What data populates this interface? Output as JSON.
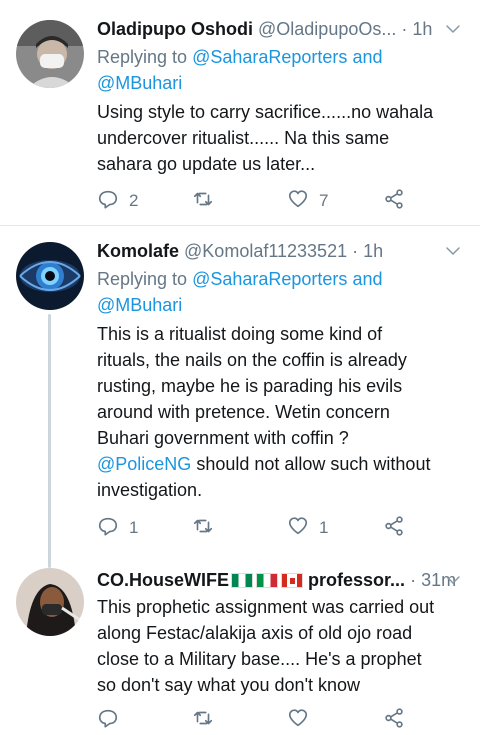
{
  "tweets": [
    {
      "name": "Oladipupo Oshodi",
      "handle": "@OladipupoOs...",
      "dot": "·",
      "time": "1h",
      "replying_label": "Replying to",
      "mention1": "@SaharaReporters",
      "and_word": "and",
      "mention2": "@MBuhari",
      "line1": "Using style to carry sacrifice......no wahala",
      "line2": "undercover ritualist...... Na this same",
      "line3": "sahara go update us later...",
      "reply_count": "2",
      "retweet_count": "",
      "like_count": "7"
    },
    {
      "name": "Komolafe",
      "handle": "@Komolaf11233521",
      "dot": "·",
      "time": "1h",
      "replying_label": "Replying to",
      "mention1": "@SaharaReporters",
      "and_word": "and",
      "mention2": "@MBuhari",
      "line1": "This is a ritualist doing some kind of",
      "line2": "rituals, the nails on the coffin is already",
      "line3": "rusting, maybe he is parading his evils",
      "line4": "around with pretence. Wetin concern",
      "line5": "Buhari government with coffin ?",
      "mention_inline": "@PoliceNG",
      "line6_rest": " should not allow such without",
      "line7": "investigation.",
      "reply_count": "1",
      "retweet_count": "",
      "like_count": "1"
    },
    {
      "name": "CO.HouseWIFE",
      "name_suffix": "professor...",
      "dot": "·",
      "time": "31m",
      "line1": "This prophetic assignment was carried out",
      "line2": "along Festac/alakija axis of old ojo road",
      "line3": "close to a Military base.... He's a prophet",
      "line4": "so don't say what you don't know",
      "reply_count": "",
      "retweet_count": "",
      "like_count": ""
    }
  ],
  "icons": [
    "reply-icon",
    "retweet-icon",
    "like-icon",
    "share-icon",
    "chevron-down-icon"
  ],
  "colors": {
    "link": "#1b95e0",
    "secondary": "#657786",
    "text": "#14171a",
    "divider": "#e1e8ed",
    "thread_line": "#ccd6dd"
  }
}
